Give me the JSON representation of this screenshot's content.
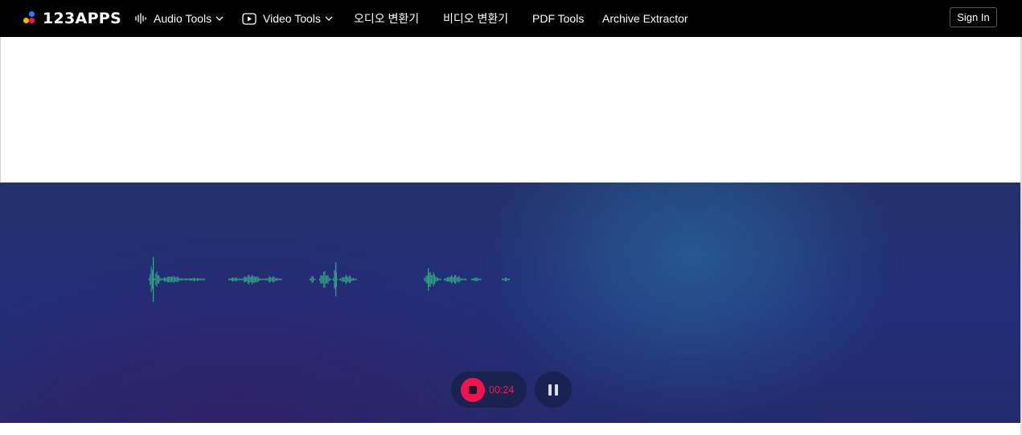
{
  "header": {
    "logo_text": "123APPS",
    "nav": [
      {
        "label": "Audio Tools",
        "icon": "waveform-icon",
        "has_dropdown": true
      },
      {
        "label": "Video Tools",
        "icon": "play-icon",
        "has_dropdown": true
      },
      {
        "label": "오디오 변환기"
      },
      {
        "label": "비디오 변환기"
      },
      {
        "label": "PDF Tools"
      },
      {
        "label": "Archive Extractor"
      }
    ],
    "sign_in": "Sign In"
  },
  "recorder": {
    "timer": "00:24",
    "stop_icon": "stop-icon",
    "pause_icon": "pause-icon"
  },
  "colors": {
    "header_bg": "#000000",
    "recorder_bg": "#222e78",
    "waveform": "#2fb48a",
    "record_red": "#f0134d",
    "logo_dots": [
      "#f5b800",
      "#2d7ff9",
      "#f0134d",
      "#23c36b"
    ]
  }
}
